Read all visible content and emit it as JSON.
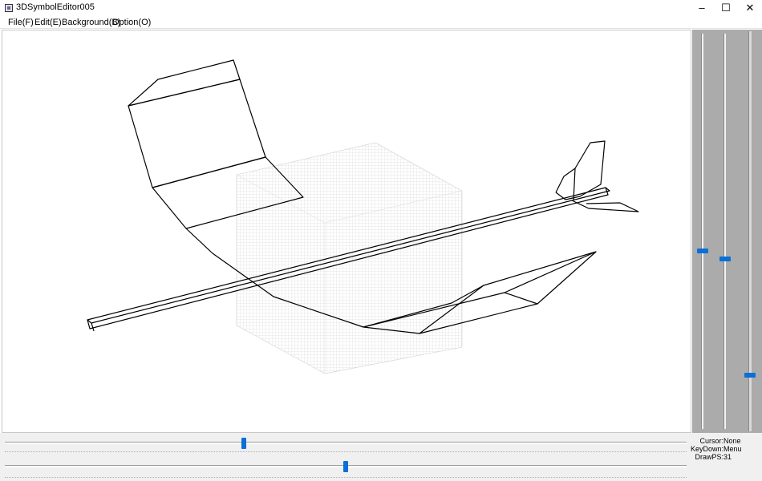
{
  "window": {
    "title": "3DSymbolEditor005",
    "minimize": "–",
    "maximize": "☐",
    "close": "✕"
  },
  "menu": {
    "file": "File(F)",
    "edit": "Edit(E)",
    "background": "Background(B)",
    "option": "Option(O)"
  },
  "status": {
    "cursor_label": "Cursor:",
    "cursor_value": "None",
    "keydown_label": "KeyDown:",
    "keydown_value": "Menu",
    "drawps_label": "DrawPS:",
    "drawps_value": "31"
  },
  "sliders": {
    "vertical_1": 0.55,
    "vertical_2": 0.57,
    "vertical_3": 0.86,
    "horizontal_1": 0.35,
    "horizontal_2": 0.5
  },
  "colors": {
    "accent": "#0a6fd6",
    "panel": "#ababab",
    "grid": "#cfcfcf",
    "wireframe": "#000000"
  }
}
